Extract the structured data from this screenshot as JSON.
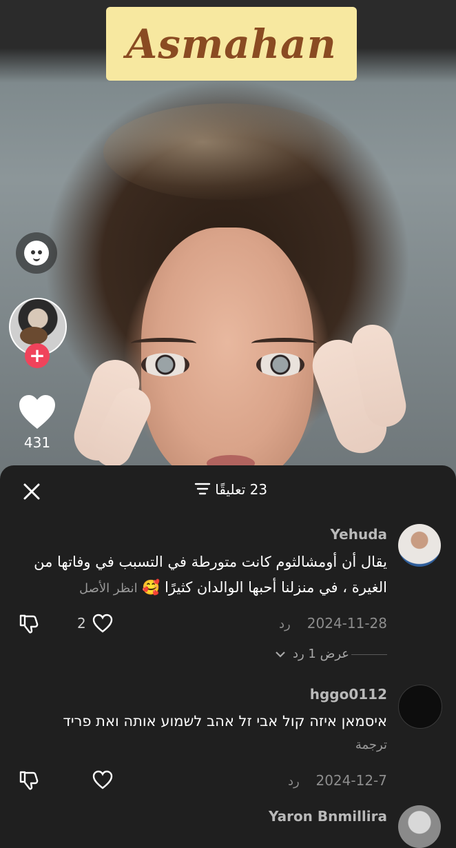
{
  "video": {
    "title_text": "Asmahan",
    "like_count": "431"
  },
  "icons": {
    "rail": [
      "face-icon",
      "plus-icon",
      "heart-icon"
    ],
    "sheet": [
      "close-icon",
      "sort-icon",
      "dislike-icon",
      "heart-outline-icon",
      "chevron-down-icon"
    ]
  },
  "colors": {
    "title_badge_bg": "#f7e8a0",
    "title_text": "#8a4b22",
    "follow_button": "#f0435b",
    "sheet_bg": "#1f1f1f"
  },
  "comments_sheet": {
    "title": "23 تعليقًا",
    "comments": [
      {
        "username": "Yehuda",
        "text": "يقال أن أومشالثوم كانت متورطة في التسبب في وفاتها من الغيرة ، في منزلنا أحبها الوالدان كثيرًا 🥰",
        "see_original": "انظر الأصل",
        "date": "2024-11-28",
        "reply": "رد",
        "likes": "2",
        "view_replies": "عرض 1 رد"
      },
      {
        "username": "hggo0112",
        "text": "איסמאן איזה קול אבי זל אהב לשמוע אותה ואת פריד",
        "translate": "ترجمة",
        "date": "2024-12-7",
        "reply": "رد"
      },
      {
        "username": "Yaron Bnmillira"
      }
    ]
  }
}
